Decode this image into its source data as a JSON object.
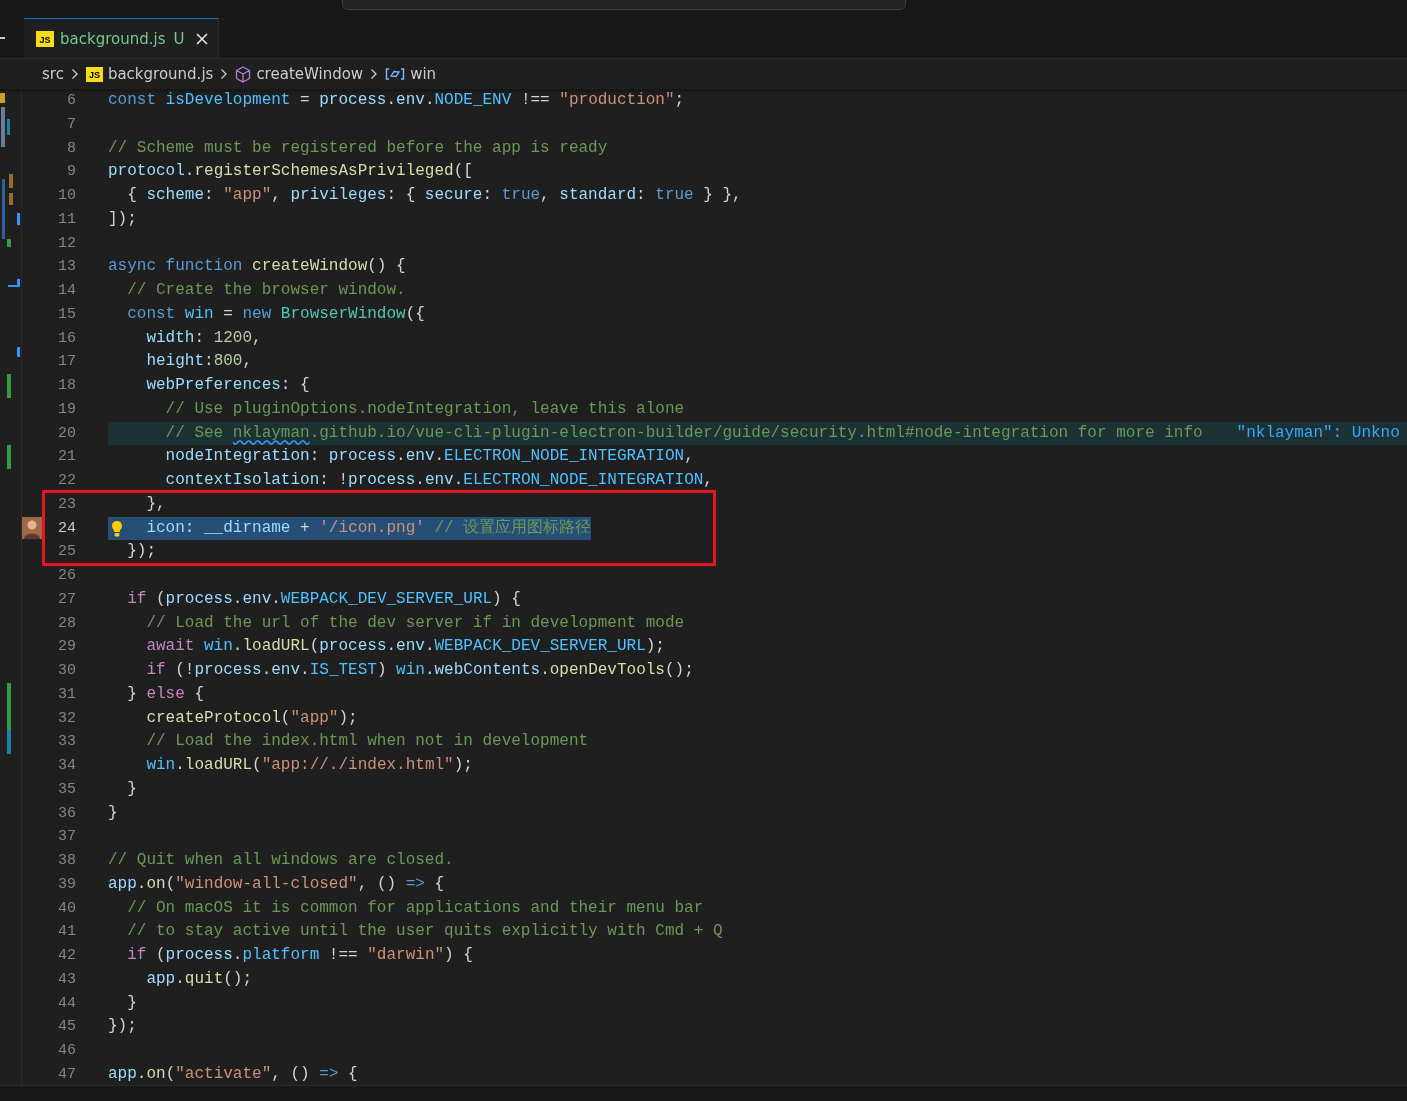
{
  "tabs": [
    {
      "icon_text": "JS",
      "label": "background.js",
      "status": "U",
      "selected": true
    }
  ],
  "breadcrumbs": [
    {
      "kind": "folder",
      "label": "src"
    },
    {
      "kind": "file",
      "icon_text": "JS",
      "label": "background.js"
    },
    {
      "kind": "function",
      "label": "createWindow"
    },
    {
      "kind": "variable",
      "label": "win"
    }
  ],
  "editor": {
    "lines": [
      {
        "number": "6",
        "selected": false,
        "highlighted": false,
        "added": false,
        "modified": false,
        "tokens": [
          {
            "kind": "kw",
            "text": "const "
          },
          {
            "kind": "c",
            "text": "isDevelopment"
          },
          {
            "kind": "p",
            "text": " = "
          },
          {
            "kind": "v",
            "text": "process"
          },
          {
            "kind": "p",
            "text": "."
          },
          {
            "kind": "v",
            "text": "env"
          },
          {
            "kind": "p",
            "text": "."
          },
          {
            "kind": "c",
            "text": "NODE_ENV"
          },
          {
            "kind": "p",
            "text": " !== "
          },
          {
            "kind": "s",
            "text": "\"production\""
          },
          {
            "kind": "p",
            "text": ";"
          }
        ]
      },
      {
        "number": "7",
        "selected": false,
        "highlighted": false,
        "added": false,
        "modified": false
      },
      {
        "number": "8",
        "selected": false,
        "highlighted": false,
        "added": false,
        "modified": false,
        "tokens": [
          {
            "kind": "m",
            "text": "// Scheme must be registered before the app is ready"
          }
        ]
      },
      {
        "number": "9",
        "selected": false,
        "highlighted": false,
        "added": false,
        "modified": false,
        "tokens": [
          {
            "kind": "v",
            "text": "protocol"
          },
          {
            "kind": "p",
            "text": "."
          },
          {
            "kind": "f",
            "text": "registerSchemesAsPrivileged"
          },
          {
            "kind": "p",
            "text": "(["
          }
        ]
      },
      {
        "number": "10",
        "selected": false,
        "highlighted": false,
        "added": false,
        "modified": false,
        "tokens": [
          {
            "kind": "p",
            "text": "  { "
          },
          {
            "kind": "v",
            "text": "scheme"
          },
          {
            "kind": "p",
            "text": ": "
          },
          {
            "kind": "s",
            "text": "\"app\""
          },
          {
            "kind": "p",
            "text": ", "
          },
          {
            "kind": "v",
            "text": "privileges"
          },
          {
            "kind": "p",
            "text": ": { "
          },
          {
            "kind": "v",
            "text": "secure"
          },
          {
            "kind": "p",
            "text": ": "
          },
          {
            "kind": "kw",
            "text": "true"
          },
          {
            "kind": "p",
            "text": ", "
          },
          {
            "kind": "v",
            "text": "standard"
          },
          {
            "kind": "p",
            "text": ": "
          },
          {
            "kind": "kw",
            "text": "true"
          },
          {
            "kind": "p",
            "text": " } },"
          }
        ]
      },
      {
        "number": "11",
        "selected": false,
        "highlighted": false,
        "added": false,
        "modified": false,
        "tokens": [
          {
            "kind": "p",
            "text": "]);"
          }
        ]
      },
      {
        "number": "12",
        "selected": false,
        "highlighted": false,
        "added": false,
        "modified": false
      },
      {
        "number": "13",
        "selected": false,
        "highlighted": false,
        "added": false,
        "modified": false,
        "tokens": [
          {
            "kind": "kw",
            "text": "async function "
          },
          {
            "kind": "f",
            "text": "createWindow"
          },
          {
            "kind": "p",
            "text": "() {"
          }
        ]
      },
      {
        "number": "14",
        "selected": false,
        "highlighted": false,
        "added": false,
        "modified": false,
        "tokens": [
          {
            "kind": "m",
            "text": "  // Create the browser window."
          }
        ]
      },
      {
        "number": "15",
        "selected": false,
        "highlighted": false,
        "added": false,
        "modified": false,
        "tokens": [
          {
            "kind": "kw",
            "text": "  const "
          },
          {
            "kind": "c",
            "text": "win"
          },
          {
            "kind": "p",
            "text": " = "
          },
          {
            "kind": "kw",
            "text": "new "
          },
          {
            "kind": "t",
            "text": "BrowserWindow"
          },
          {
            "kind": "p",
            "text": "({"
          }
        ]
      },
      {
        "number": "16",
        "selected": false,
        "highlighted": false,
        "added": false,
        "modified": false,
        "tokens": [
          {
            "kind": "v",
            "text": "    width"
          },
          {
            "kind": "p",
            "text": ": "
          },
          {
            "kind": "n",
            "text": "1200"
          },
          {
            "kind": "p",
            "text": ","
          }
        ]
      },
      {
        "number": "17",
        "selected": false,
        "highlighted": false,
        "added": false,
        "modified": false,
        "tokens": [
          {
            "kind": "v",
            "text": "    height"
          },
          {
            "kind": "p",
            "text": ":"
          },
          {
            "kind": "n",
            "text": "800"
          },
          {
            "kind": "p",
            "text": ","
          }
        ]
      },
      {
        "number": "18",
        "selected": false,
        "highlighted": false,
        "added": true,
        "modified": false,
        "tokens": [
          {
            "kind": "v",
            "text": "    webPreferences"
          },
          {
            "kind": "p",
            "text": ": {"
          }
        ]
      },
      {
        "number": "19",
        "selected": false,
        "highlighted": false,
        "added": false,
        "modified": false,
        "tokens": [
          {
            "kind": "m",
            "text": "      // Use pluginOptions.nodeIntegration, leave this alone"
          }
        ]
      },
      {
        "number": "20",
        "selected": false,
        "highlighted": true,
        "added": false,
        "modified": false,
        "tokens": [
          {
            "kind": "m",
            "text": "      // See "
          },
          {
            "kind": "w",
            "text": "nklayman"
          },
          {
            "kind": "m",
            "text": ".github.io/vue-cli-plugin-electron-builder/guide/security.html#node-integration for more info"
          }
        ],
        "hint": "\"nklayman\": Unkno"
      },
      {
        "number": "21",
        "selected": false,
        "highlighted": false,
        "added": true,
        "modified": false,
        "tokens": [
          {
            "kind": "v",
            "text": "      nodeIntegration"
          },
          {
            "kind": "p",
            "text": ": "
          },
          {
            "kind": "v",
            "text": "process"
          },
          {
            "kind": "p",
            "text": "."
          },
          {
            "kind": "v",
            "text": "env"
          },
          {
            "kind": "p",
            "text": "."
          },
          {
            "kind": "c",
            "text": "ELECTRON_NODE_INTEGRATION"
          },
          {
            "kind": "p",
            "text": ","
          }
        ]
      },
      {
        "number": "22",
        "selected": false,
        "highlighted": false,
        "added": false,
        "modified": false,
        "tokens": [
          {
            "kind": "v",
            "text": "      contextIsolation"
          },
          {
            "kind": "p",
            "text": ": !"
          },
          {
            "kind": "v",
            "text": "process"
          },
          {
            "kind": "p",
            "text": "."
          },
          {
            "kind": "v",
            "text": "env"
          },
          {
            "kind": "p",
            "text": "."
          },
          {
            "kind": "c",
            "text": "ELECTRON_NODE_INTEGRATION"
          },
          {
            "kind": "p",
            "text": ","
          }
        ]
      },
      {
        "number": "23",
        "selected": false,
        "highlighted": false,
        "added": false,
        "modified": false,
        "tokens": [
          {
            "kind": "p",
            "text": "    },"
          }
        ]
      },
      {
        "number": "24",
        "selected": true,
        "highlighted": false,
        "added": false,
        "modified": false,
        "tokens": [
          {
            "kind": "v",
            "text": "    icon"
          },
          {
            "kind": "p",
            "text": ": "
          },
          {
            "kind": "v",
            "text": "__dirname"
          },
          {
            "kind": "p",
            "text": " + "
          },
          {
            "kind": "s",
            "text": "'/icon.png'"
          },
          {
            "kind": "m",
            "text": " // 设置应用图标路径"
          }
        ]
      },
      {
        "number": "25",
        "selected": false,
        "highlighted": false,
        "added": false,
        "modified": false,
        "tokens": [
          {
            "kind": "p",
            "text": "  });"
          }
        ]
      },
      {
        "number": "26",
        "selected": false,
        "highlighted": false,
        "added": false,
        "modified": false
      },
      {
        "number": "27",
        "selected": false,
        "highlighted": false,
        "added": false,
        "modified": false,
        "tokens": [
          {
            "kind": "k",
            "text": "  if"
          },
          {
            "kind": "p",
            "text": " ("
          },
          {
            "kind": "v",
            "text": "process"
          },
          {
            "kind": "p",
            "text": "."
          },
          {
            "kind": "v",
            "text": "env"
          },
          {
            "kind": "p",
            "text": "."
          },
          {
            "kind": "c",
            "text": "WEBPACK_DEV_SERVER_URL"
          },
          {
            "kind": "p",
            "text": ") {"
          }
        ]
      },
      {
        "number": "28",
        "selected": false,
        "highlighted": false,
        "added": false,
        "modified": false,
        "tokens": [
          {
            "kind": "m",
            "text": "    // Load the url of the dev server if in development mode"
          }
        ]
      },
      {
        "number": "29",
        "selected": false,
        "highlighted": false,
        "added": false,
        "modified": false,
        "tokens": [
          {
            "kind": "k",
            "text": "    await "
          },
          {
            "kind": "c",
            "text": "win"
          },
          {
            "kind": "p",
            "text": "."
          },
          {
            "kind": "f",
            "text": "loadURL"
          },
          {
            "kind": "p",
            "text": "("
          },
          {
            "kind": "v",
            "text": "process"
          },
          {
            "kind": "p",
            "text": "."
          },
          {
            "kind": "v",
            "text": "env"
          },
          {
            "kind": "p",
            "text": "."
          },
          {
            "kind": "c",
            "text": "WEBPACK_DEV_SERVER_URL"
          },
          {
            "kind": "p",
            "text": ");"
          }
        ]
      },
      {
        "number": "30",
        "selected": false,
        "highlighted": false,
        "added": false,
        "modified": false,
        "tokens": [
          {
            "kind": "k",
            "text": "    if"
          },
          {
            "kind": "p",
            "text": " (!"
          },
          {
            "kind": "v",
            "text": "process"
          },
          {
            "kind": "p",
            "text": "."
          },
          {
            "kind": "v",
            "text": "env"
          },
          {
            "kind": "p",
            "text": "."
          },
          {
            "kind": "c",
            "text": "IS_TEST"
          },
          {
            "kind": "p",
            "text": ") "
          },
          {
            "kind": "c",
            "text": "win"
          },
          {
            "kind": "p",
            "text": "."
          },
          {
            "kind": "v",
            "text": "webContents"
          },
          {
            "kind": "p",
            "text": "."
          },
          {
            "kind": "f",
            "text": "openDevTools"
          },
          {
            "kind": "p",
            "text": "();"
          }
        ]
      },
      {
        "number": "31",
        "selected": false,
        "highlighted": false,
        "added": true,
        "modified": false,
        "tokens": [
          {
            "kind": "p",
            "text": "  } "
          },
          {
            "kind": "k",
            "text": "else"
          },
          {
            "kind": "p",
            "text": " {"
          }
        ]
      },
      {
        "number": "32",
        "selected": false,
        "highlighted": false,
        "added": true,
        "modified": false,
        "tokens": [
          {
            "kind": "f",
            "text": "    createProtocol"
          },
          {
            "kind": "p",
            "text": "("
          },
          {
            "kind": "s",
            "text": "\"app\""
          },
          {
            "kind": "p",
            "text": ");"
          }
        ]
      },
      {
        "number": "33",
        "selected": false,
        "highlighted": false,
        "added": false,
        "modified": true,
        "tokens": [
          {
            "kind": "m",
            "text": "    // Load the index.html when not in development"
          }
        ]
      },
      {
        "number": "34",
        "selected": false,
        "highlighted": false,
        "added": false,
        "modified": false,
        "tokens": [
          {
            "kind": "c",
            "text": "    win"
          },
          {
            "kind": "p",
            "text": "."
          },
          {
            "kind": "f",
            "text": "loadURL"
          },
          {
            "kind": "p",
            "text": "("
          },
          {
            "kind": "s",
            "text": "\"app://./index.html\""
          },
          {
            "kind": "p",
            "text": ");"
          }
        ]
      },
      {
        "number": "35",
        "selected": false,
        "highlighted": false,
        "added": false,
        "modified": false,
        "tokens": [
          {
            "kind": "p",
            "text": "  }"
          }
        ]
      },
      {
        "number": "36",
        "selected": false,
        "highlighted": false,
        "added": false,
        "modified": false,
        "tokens": [
          {
            "kind": "p",
            "text": "}"
          }
        ]
      },
      {
        "number": "37",
        "selected": false,
        "highlighted": false,
        "added": false,
        "modified": false
      },
      {
        "number": "38",
        "selected": false,
        "highlighted": false,
        "added": false,
        "modified": false,
        "tokens": [
          {
            "kind": "m",
            "text": "// Quit when all windows are closed."
          }
        ]
      },
      {
        "number": "39",
        "selected": false,
        "highlighted": false,
        "added": false,
        "modified": false,
        "tokens": [
          {
            "kind": "v",
            "text": "app"
          },
          {
            "kind": "p",
            "text": "."
          },
          {
            "kind": "f",
            "text": "on"
          },
          {
            "kind": "p",
            "text": "("
          },
          {
            "kind": "s",
            "text": "\"window-all-closed\""
          },
          {
            "kind": "p",
            "text": ", () "
          },
          {
            "kind": "kw",
            "text": "=>"
          },
          {
            "kind": "p",
            "text": " {"
          }
        ]
      },
      {
        "number": "40",
        "selected": false,
        "highlighted": false,
        "added": false,
        "modified": false,
        "tokens": [
          {
            "kind": "m",
            "text": "  // On macOS it is common for applications and their menu bar"
          }
        ]
      },
      {
        "number": "41",
        "selected": false,
        "highlighted": false,
        "added": false,
        "modified": false,
        "tokens": [
          {
            "kind": "m",
            "text": "  // to stay active until the user quits explicitly with Cmd + Q"
          }
        ]
      },
      {
        "number": "42",
        "selected": false,
        "highlighted": false,
        "added": false,
        "modified": false,
        "tokens": [
          {
            "kind": "k",
            "text": "  if"
          },
          {
            "kind": "p",
            "text": " ("
          },
          {
            "kind": "v",
            "text": "process"
          },
          {
            "kind": "p",
            "text": "."
          },
          {
            "kind": "c",
            "text": "platform"
          },
          {
            "kind": "p",
            "text": " !== "
          },
          {
            "kind": "s",
            "text": "\"darwin\""
          },
          {
            "kind": "p",
            "text": ") {"
          }
        ]
      },
      {
        "number": "43",
        "selected": false,
        "highlighted": false,
        "added": false,
        "modified": false,
        "tokens": [
          {
            "kind": "v",
            "text": "    app"
          },
          {
            "kind": "p",
            "text": "."
          },
          {
            "kind": "f",
            "text": "quit"
          },
          {
            "kind": "p",
            "text": "();"
          }
        ]
      },
      {
        "number": "44",
        "selected": false,
        "highlighted": false,
        "added": false,
        "modified": false,
        "tokens": [
          {
            "kind": "p",
            "text": "  }"
          }
        ]
      },
      {
        "number": "45",
        "selected": false,
        "highlighted": false,
        "added": false,
        "modified": false,
        "tokens": [
          {
            "kind": "p",
            "text": "});"
          }
        ]
      },
      {
        "number": "46",
        "selected": false,
        "highlighted": false,
        "added": false,
        "modified": false
      },
      {
        "number": "47",
        "selected": false,
        "highlighted": false,
        "added": false,
        "modified": false,
        "tokens": [
          {
            "kind": "v",
            "text": "app"
          },
          {
            "kind": "p",
            "text": "."
          },
          {
            "kind": "f",
            "text": "on"
          },
          {
            "kind": "p",
            "text": "("
          },
          {
            "kind": "s",
            "text": "\"activate\""
          },
          {
            "kind": "p",
            "text": ", () "
          },
          {
            "kind": "kw",
            "text": "=>"
          },
          {
            "kind": "p",
            "text": " {"
          }
        ]
      }
    ]
  }
}
